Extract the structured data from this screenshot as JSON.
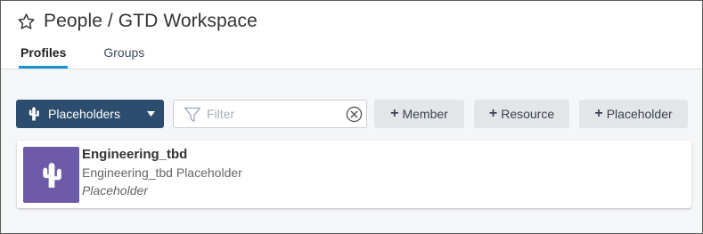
{
  "header": {
    "title": "People / GTD Workspace"
  },
  "tabs": [
    {
      "label": "Profiles",
      "active": true
    },
    {
      "label": "Groups",
      "active": false
    }
  ],
  "toolbar": {
    "type_dropdown": {
      "label": "Placeholders",
      "icon": "cactus-icon"
    },
    "filter": {
      "placeholder": "Filter",
      "value": ""
    },
    "buttons": {
      "member": "Member",
      "resource": "Resource",
      "placeholder": "Placeholder",
      "plus": "+"
    }
  },
  "results": [
    {
      "name": "Engineering_tbd",
      "description": "Engineering_tbd Placeholder",
      "type": "Placeholder",
      "avatar_icon": "cactus-icon"
    }
  ],
  "colors": {
    "accent": "#1a8fd6",
    "dropdown_bg": "#2d4d6e",
    "avatar_bg": "#6e5ba8"
  }
}
